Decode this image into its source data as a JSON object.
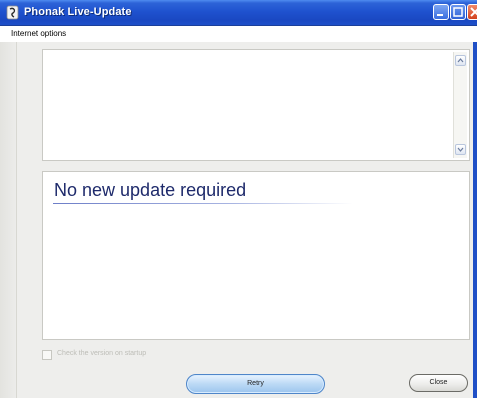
{
  "window": {
    "title": "Phonak Live-Update"
  },
  "menu": {
    "items": [
      {
        "label": "Internet options"
      }
    ]
  },
  "log": {
    "text": ""
  },
  "status": {
    "message": "No new update required"
  },
  "options": {
    "check_on_startup_label": "Check the version on startup",
    "check_on_startup_checked": false
  },
  "buttons": {
    "retry_label": "Retry",
    "close_label": "Close"
  },
  "colors": {
    "titlebar": "#1f52cf",
    "status_text": "#1e2a6b",
    "retry_button": "#bcd9f5"
  },
  "icons": {
    "app": "phonak-app-icon",
    "minimize": "minimize-icon",
    "maximize": "maximize-icon",
    "close": "close-icon",
    "scroll_up": "scroll-up-arrow-icon",
    "scroll_down": "scroll-down-arrow-icon"
  }
}
